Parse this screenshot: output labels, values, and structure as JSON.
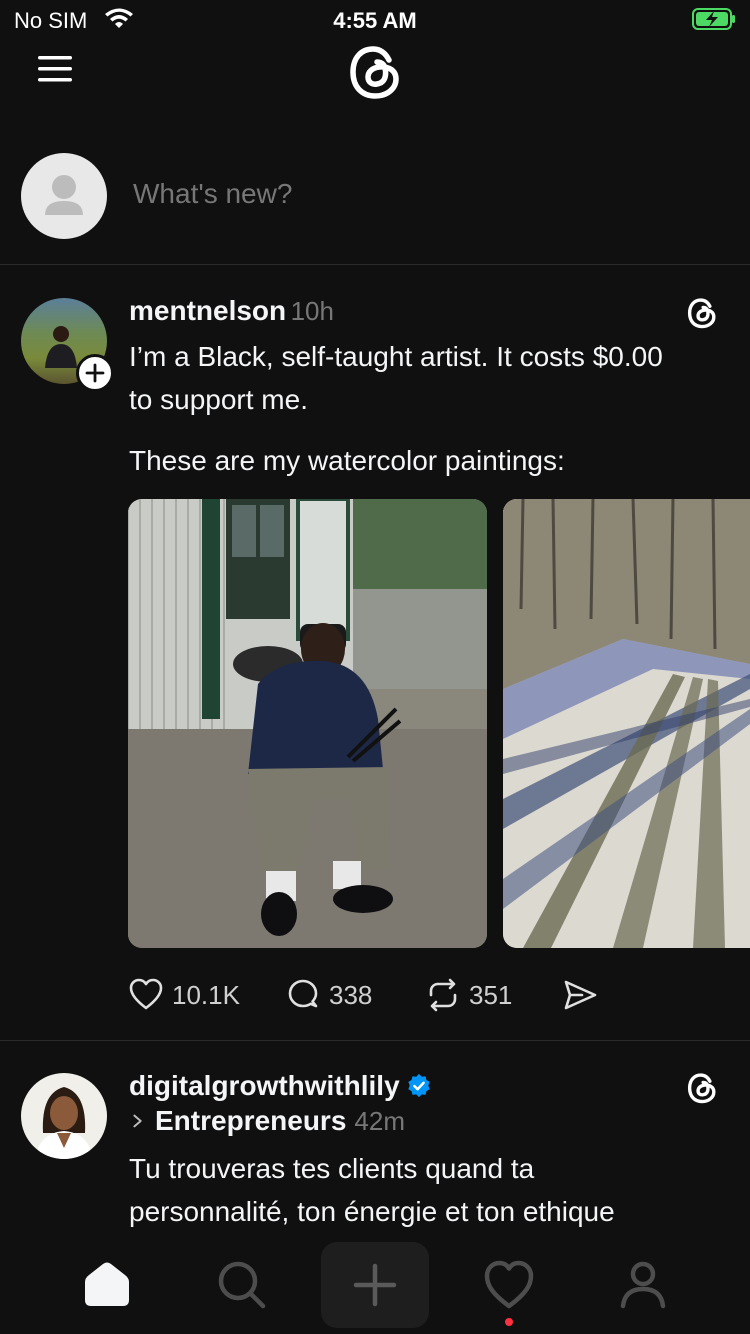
{
  "status_bar": {
    "carrier": "No SIM",
    "time": "4:55 AM"
  },
  "composer": {
    "placeholder": "What's new?"
  },
  "posts": [
    {
      "username": "mentnelson",
      "time": "10h",
      "text_line1": "I’m a Black, self-taught artist. It costs $0.00",
      "text_line2": "to support me.",
      "text_line3": "These are my watercolor paintings:",
      "likes": "10.1K",
      "replies": "338",
      "reposts": "351"
    },
    {
      "username": "digitalgrowthwithlily",
      "community": "Entrepreneurs",
      "time": "42m",
      "text_line1": "Tu trouveras tes clients quand ta",
      "text_line2": "personnalité, ton énergie et ton ethique"
    }
  ],
  "colors": {
    "background": "#101010",
    "text": "#f3f5f7",
    "muted": "#777777",
    "verified": "#0095f6",
    "notification_dot": "#ff3040",
    "battery": "#4cd964"
  },
  "icons": [
    "menu-icon",
    "threads-logo-icon",
    "heart-icon",
    "reply-icon",
    "repost-icon",
    "share-icon",
    "home-icon",
    "search-icon",
    "plus-icon",
    "activity-icon",
    "profile-icon"
  ]
}
